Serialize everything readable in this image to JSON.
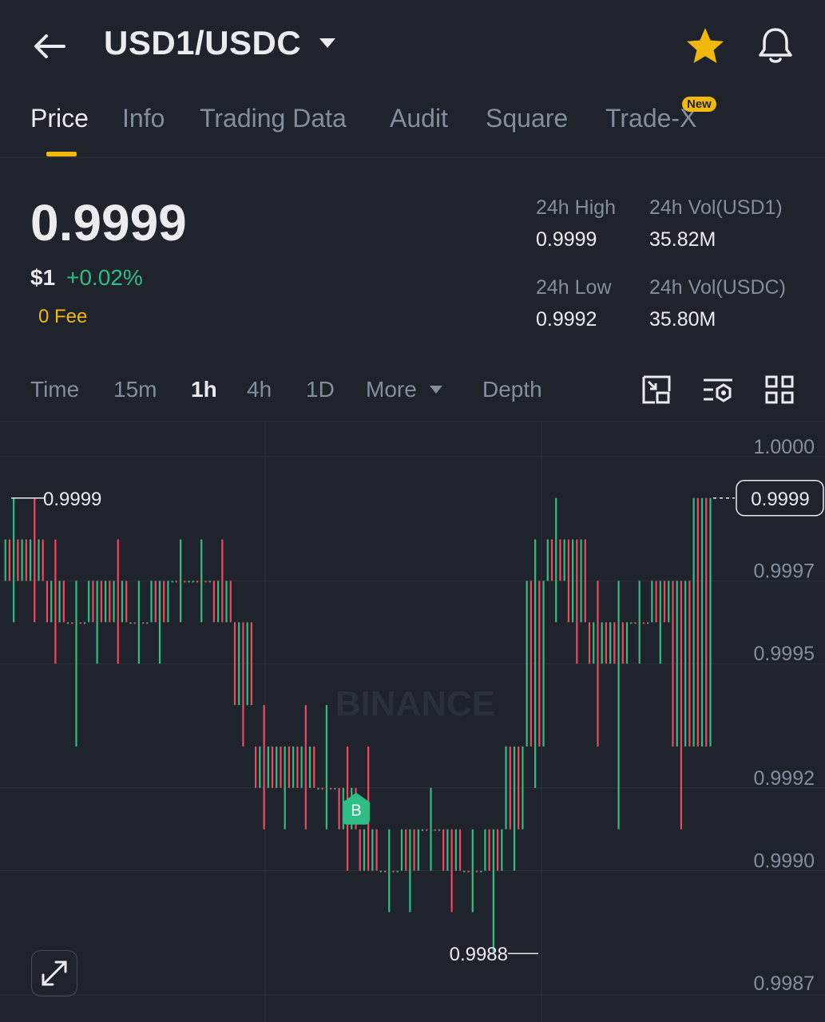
{
  "header": {
    "pair": "USD1/USDC",
    "back_icon": "arrow-left-icon",
    "dropdown_icon": "caret-down-icon",
    "favorite_icon": "star-icon",
    "alert_icon": "bell-icon"
  },
  "tabs": {
    "items": [
      {
        "label": "Price",
        "active": true
      },
      {
        "label": "Info"
      },
      {
        "label": "Trading Data"
      },
      {
        "label": "Audit"
      },
      {
        "label": "Square"
      },
      {
        "label": "Trade-X",
        "badge": "New"
      }
    ]
  },
  "price": {
    "last": "0.9999",
    "usd": "$1",
    "change": "+0.02%",
    "fee": "0 Fee"
  },
  "stats": {
    "high_label": "24h High",
    "high": "0.9999",
    "low_label": "24h Low",
    "low": "0.9992",
    "vol_base_label": "24h Vol(USD1)",
    "vol_base": "35.82M",
    "vol_quote_label": "24h Vol(USDC)",
    "vol_quote": "35.80M"
  },
  "intervals": {
    "items": [
      {
        "label": "Time"
      },
      {
        "label": "15m"
      },
      {
        "label": "1h",
        "active": true
      },
      {
        "label": "4h"
      },
      {
        "label": "1D"
      },
      {
        "label": "More"
      },
      {
        "label": "Depth"
      }
    ],
    "tools": [
      "picture-in-picture-icon",
      "indicator-settings-icon",
      "grid-layout-icon"
    ]
  },
  "chart_data": {
    "type": "candlestick",
    "y_ticks": [
      "1.0000",
      "0.9997",
      "0.9995",
      "0.9992",
      "0.9990",
      "0.9987"
    ],
    "last_price": "0.9999",
    "high_marker": "0.9999",
    "low_marker": "0.9988",
    "buy_marker": "B",
    "watermark": "BINANCE",
    "colors": {
      "up": "#2ebd85",
      "down": "#f6465d",
      "bg": "#1f232b",
      "grid": "#2b3139"
    },
    "candles_ohlc": [
      [
        0.9997,
        0.9999,
        0.9996,
        0.9998
      ],
      [
        0.9998,
        0.9999,
        0.9996,
        0.9997
      ],
      [
        0.9997,
        0.9998,
        0.9995,
        0.9996
      ],
      [
        0.9996,
        0.9997,
        0.9993,
        0.9996
      ],
      [
        0.9996,
        0.9997,
        0.9995,
        0.9997
      ],
      [
        0.9997,
        0.9998,
        0.9995,
        0.9996
      ],
      [
        0.9996,
        0.9997,
        0.9995,
        0.9996
      ],
      [
        0.9996,
        0.9997,
        0.9995,
        0.9997
      ],
      [
        0.9997,
        0.9998,
        0.9996,
        0.9997
      ],
      [
        0.9997,
        0.9998,
        0.9996,
        0.9997
      ],
      [
        0.9997,
        0.9998,
        0.9996,
        0.9996
      ],
      [
        0.9996,
        0.9996,
        0.9993,
        0.9994
      ],
      [
        0.9993,
        0.9994,
        0.9991,
        0.9992
      ],
      [
        0.9992,
        0.9993,
        0.9991,
        0.9993
      ],
      [
        0.9993,
        0.9994,
        0.9991,
        0.9992
      ],
      [
        0.9992,
        0.9994,
        0.9991,
        0.9992
      ],
      [
        0.9992,
        0.9993,
        0.999,
        0.9991
      ],
      [
        0.9991,
        0.9993,
        0.999,
        0.999
      ],
      [
        0.999,
        0.9991,
        0.9989,
        0.999
      ],
      [
        0.999,
        0.9991,
        0.9989,
        0.9991
      ],
      [
        0.9991,
        0.9992,
        0.999,
        0.9991
      ],
      [
        0.9991,
        0.9991,
        0.9989,
        0.999
      ],
      [
        0.999,
        0.9991,
        0.9989,
        0.999
      ],
      [
        0.999,
        0.9991,
        0.9988,
        0.9991
      ],
      [
        0.9991,
        0.9993,
        0.999,
        0.9993
      ],
      [
        0.9993,
        0.9998,
        0.9992,
        0.9997
      ],
      [
        0.9997,
        0.9999,
        0.9996,
        0.9998
      ],
      [
        0.9998,
        0.9998,
        0.9995,
        0.9996
      ],
      [
        0.9996,
        0.9997,
        0.9993,
        0.9995
      ],
      [
        0.9995,
        0.9997,
        0.9991,
        0.9996
      ],
      [
        0.9996,
        0.9997,
        0.9995,
        0.9996
      ],
      [
        0.9996,
        0.9997,
        0.9995,
        0.9997
      ],
      [
        0.9997,
        0.9997,
        0.9991,
        0.9993
      ],
      [
        0.9993,
        0.9999,
        0.9993,
        0.9999
      ]
    ]
  }
}
